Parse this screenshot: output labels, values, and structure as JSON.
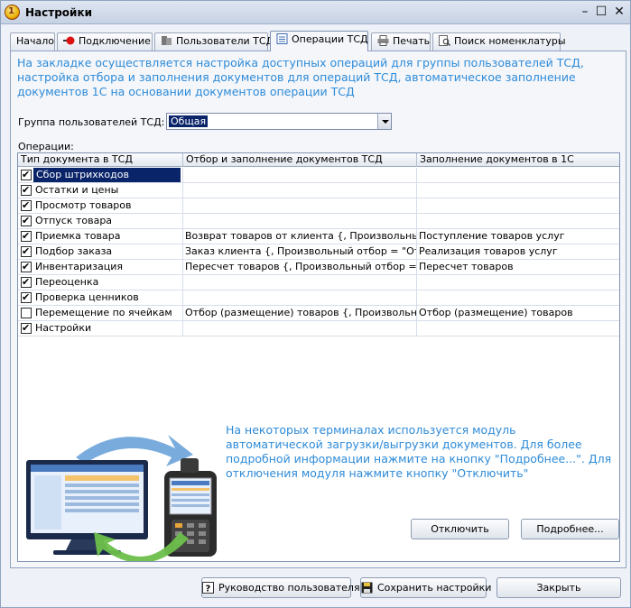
{
  "window": {
    "title": "Настройки"
  },
  "tabs": [
    {
      "label": "Начало"
    },
    {
      "label": "Подключение",
      "icon": "plug-icon"
    },
    {
      "label": "Пользователи ТСД",
      "icon": "users-icon"
    },
    {
      "label": "Операции ТСД",
      "icon": "operations-icon"
    },
    {
      "label": "Печать",
      "icon": "printer-icon"
    },
    {
      "label": "Поиск номенклатуры",
      "icon": "search-icon"
    }
  ],
  "intro_text": "На закладке осуществляется настройка доступных операций для группы пользователей ТСД, настройка отбора и заполнения документов для операций ТСД, автоматическое заполнение документов 1С на основании документов операции ТСД",
  "group": {
    "label": "Группа пользователей ТСД:",
    "value": "Общая"
  },
  "operations": {
    "label": "Операции:",
    "columns": [
      "Тип документа в ТСД",
      "Отбор  и заполнение документов ТСД",
      "Заполнение документов в 1С"
    ],
    "rows": [
      {
        "checked": true,
        "name": "Сбор штрихкодов",
        "filter": "",
        "fill": ""
      },
      {
        "checked": true,
        "name": "Остатки и цены",
        "filter": "",
        "fill": ""
      },
      {
        "checked": true,
        "name": "Просмотр товаров",
        "filter": "",
        "fill": ""
      },
      {
        "checked": true,
        "name": "Отпуск товара",
        "filter": "",
        "fill": ""
      },
      {
        "checked": true,
        "name": "Приемка товара",
        "filter": "Возврат товаров от клиента {, Произвольный о...",
        "fill": "Поступление товаров услуг"
      },
      {
        "checked": true,
        "name": "Подбор заказа",
        "filter": "Заказ клиента {, Произвольный отбор = \"Отбор...",
        "fill": "Реализация товаров услуг"
      },
      {
        "checked": true,
        "name": "Инвентаризация",
        "filter": "Пересчет товаров {, Произвольный отбор = \"От...",
        "fill": "Пересчет товаров"
      },
      {
        "checked": true,
        "name": "Переоценка",
        "filter": "",
        "fill": ""
      },
      {
        "checked": true,
        "name": "Проверка ценников",
        "filter": "",
        "fill": ""
      },
      {
        "checked": false,
        "name": "Перемещение по ячейкам",
        "filter": "Отбор (размещение) товаров {, Произвольный ...",
        "fill": "Отбор (размещение) товаров"
      },
      {
        "checked": true,
        "name": "Настройки",
        "filter": "",
        "fill": ""
      }
    ],
    "selected_row": 0
  },
  "info_text": "На некоторых терминалах используется модуль автоматической загрузки/выгрузки документов. Для более подробной информации нажмите на кнопку \"Подробнее...\". Для отключения модуля нажмите кнопку \"Отключить\"",
  "buttons": {
    "disable": "Отключить",
    "details": "Подробнее...",
    "user_guide": "Руководство пользователя",
    "save_settings": "Сохранить настройки",
    "close": "Закрыть"
  },
  "colors": {
    "accent_text": "#2e8bd8",
    "selection": "#0a246a"
  }
}
